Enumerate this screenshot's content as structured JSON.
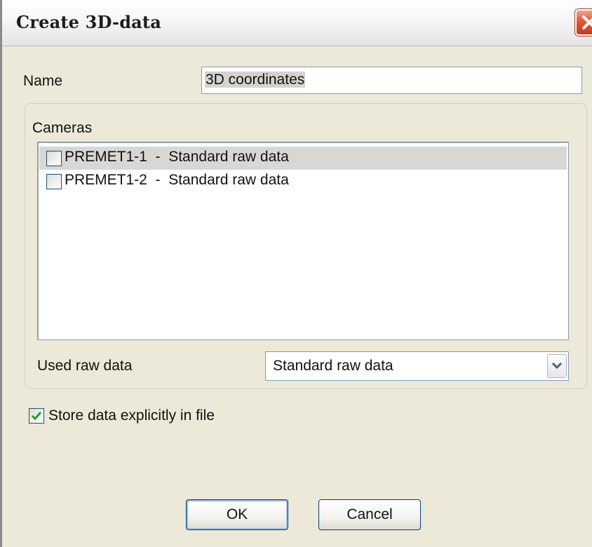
{
  "window": {
    "title": "Create 3D-data"
  },
  "name_field": {
    "label": "Name",
    "value": "3D coordinates"
  },
  "cameras": {
    "label": "Cameras",
    "items": [
      {
        "label": "PREMET1-1  -  Standard raw data",
        "checked": false,
        "selected": true
      },
      {
        "label": "PREMET1-2  -  Standard raw data",
        "checked": false,
        "selected": false
      }
    ]
  },
  "raw_data": {
    "label": "Used raw data",
    "selected": "Standard raw data"
  },
  "store_option": {
    "label": "Store data explicitly in file",
    "checked": true
  },
  "buttons": {
    "ok": "OK",
    "cancel": "Cancel"
  },
  "icons": {
    "close": "close-icon",
    "dropdown": "chevron-down-icon",
    "checkmark": "checkmark-icon"
  },
  "colors": {
    "close_button": "#e0593a",
    "check_green": "#21a121",
    "selection": "#d8d7d3"
  }
}
